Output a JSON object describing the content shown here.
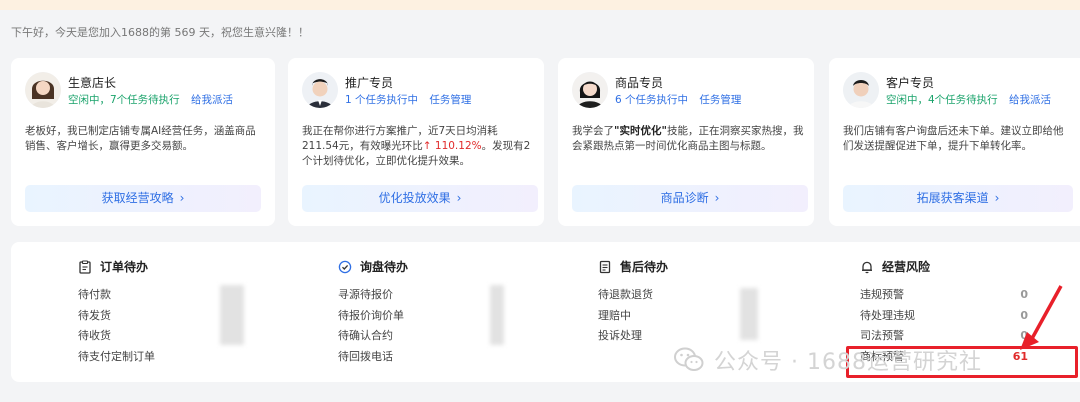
{
  "greeting": "下午好，今天是您加入1688的第 569 天，祝您生意兴隆！！",
  "agents": [
    {
      "name": "生意店长",
      "status": "空闲中，7个任务待执行",
      "status_state": "idle",
      "action": "给我派活",
      "description": "老板好，我已制定店铺专属AI经营任务，涵盖商品销售、客户增长，赢得更多交易额。",
      "cta": "获取经营攻略"
    },
    {
      "name": "推广专员",
      "status": "1 个任务执行中",
      "status_state": "busy",
      "action": "任务管理",
      "description_parts": {
        "before": "我正在帮你进行方案推广，近7天日均消耗211.54元，有效曝光环比",
        "rise": "↑ 110.12%",
        "after": "。发现有2个计划待优化，立即优化提升效果。"
      },
      "cta": "优化投放效果"
    },
    {
      "name": "商品专员",
      "status": "6 个任务执行中",
      "status_state": "busy",
      "action": "任务管理",
      "description_parts": {
        "before": "我学会了",
        "bold": "\"实时优化\"",
        "after": "技能，正在洞察买家热搜，我会紧跟热点第一时间优化商品主图与标题。"
      },
      "cta": "商品诊断"
    },
    {
      "name": "客户专员",
      "status": "空闲中，4个任务待执行",
      "status_state": "idle",
      "action": "给我派活",
      "description": "我们店铺有客户询盘后还未下单。建议立即给他们发送提醒促进下单，提升下单转化率。",
      "cta": "拓展获客渠道"
    }
  ],
  "todo": {
    "orders": {
      "title": "订单待办",
      "icon": "clipboard-icon",
      "items": [
        "待付款",
        "待发货",
        "待收货",
        "待支付定制订单"
      ]
    },
    "inquiry": {
      "title": "询盘待办",
      "icon": "chat-check-icon",
      "items": [
        "寻源待报价",
        "待报价询价单",
        "待确认合约",
        "待回拨电话"
      ]
    },
    "aftersales": {
      "title": "售后待办",
      "icon": "document-icon",
      "items": [
        "待退款退货",
        "理赔中",
        "投诉处理"
      ]
    },
    "risk": {
      "title": "经营风险",
      "icon": "bell-icon",
      "items": [
        {
          "label": "违规预警",
          "count": "0"
        },
        {
          "label": "待处理违规",
          "count": "0"
        },
        {
          "label": "司法预警",
          "count": "0"
        },
        {
          "label": "商标预警",
          "count": "61"
        }
      ]
    }
  },
  "watermark": "公众号 · 1688运营研究社",
  "colors": {
    "accent": "#2f6fe4",
    "idle": "#1aa36b",
    "alert": "#e02b2b",
    "highlight_box": "#e8202a"
  }
}
